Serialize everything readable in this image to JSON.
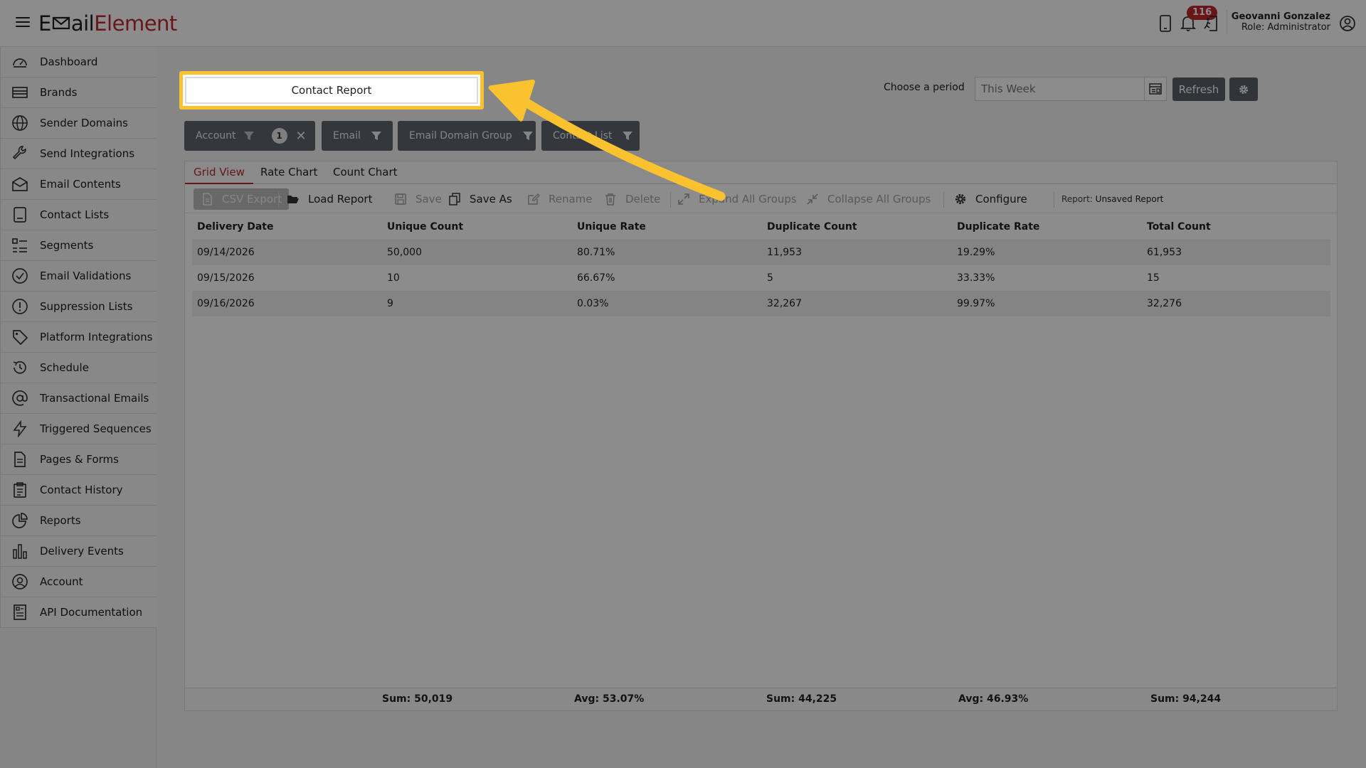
{
  "header": {
    "logo_part1": "E",
    "logo_part2": "ail",
    "logo_part3": "Element",
    "notification_count": "116",
    "user_name": "Geovanni Gonzalez",
    "user_role": "Role: Administrator"
  },
  "sidebar": {
    "items": [
      {
        "label": "Dashboard",
        "icon": "dashboard-icon"
      },
      {
        "label": "Brands",
        "icon": "brands-icon"
      },
      {
        "label": "Sender Domains",
        "icon": "globe-icon"
      },
      {
        "label": "Send Integrations",
        "icon": "wrench-icon"
      },
      {
        "label": "Email Contents",
        "icon": "envelope-icon"
      },
      {
        "label": "Contact Lists",
        "icon": "contacts-icon"
      },
      {
        "label": "Segments",
        "icon": "segments-icon"
      },
      {
        "label": "Email Validations",
        "icon": "check-circle-icon"
      },
      {
        "label": "Suppression Lists",
        "icon": "exclamation-circle-icon"
      },
      {
        "label": "Platform Integrations",
        "icon": "tag-icon"
      },
      {
        "label": "Schedule",
        "icon": "history-icon"
      },
      {
        "label": "Transactional Emails",
        "icon": "at-icon"
      },
      {
        "label": "Triggered Sequences",
        "icon": "bolt-icon"
      },
      {
        "label": "Pages & Forms",
        "icon": "document-icon"
      },
      {
        "label": "Contact History",
        "icon": "clipboard-icon"
      },
      {
        "label": "Reports",
        "icon": "pie-chart-icon"
      },
      {
        "label": "Delivery Events",
        "icon": "bar-chart-icon"
      },
      {
        "label": "Account",
        "icon": "user-circle-icon"
      },
      {
        "label": "API Documentation",
        "icon": "api-doc-icon"
      }
    ]
  },
  "main": {
    "report_title": "Contact Report",
    "period_label": "Choose a period",
    "period_value": "This Week",
    "refresh_label": "Refresh",
    "filters": [
      {
        "label": "Account",
        "count": "1"
      },
      {
        "label": "Email"
      },
      {
        "label": "Email Domain Group"
      },
      {
        "label": "Contact List"
      }
    ],
    "tabs": [
      "Grid View",
      "Rate Chart",
      "Count Chart"
    ],
    "toolbar": {
      "csv_export": "CSV Export",
      "load_report": "Load Report",
      "save": "Save",
      "save_as": "Save As",
      "rename": "Rename",
      "delete": "Delete",
      "expand_all": "Expand All Groups",
      "collapse_all": "Collapse All Groups",
      "configure": "Configure",
      "report_label": "Report:",
      "report_name": "Unsaved Report"
    },
    "table": {
      "columns": [
        "Delivery Date",
        "Unique Count",
        "Unique Rate",
        "Duplicate Count",
        "Duplicate Rate",
        "Total Count"
      ],
      "rows": [
        [
          "09/14/2026",
          "50,000",
          "80.71%",
          "11,953",
          "19.29%",
          "61,953"
        ],
        [
          "09/15/2026",
          "10",
          "66.67%",
          "5",
          "33.33%",
          "15"
        ],
        [
          "09/16/2026",
          "9",
          "0.03%",
          "32,267",
          "99.97%",
          "32,276"
        ]
      ],
      "footer": [
        "Sum: 50,019",
        "Avg: 53.07%",
        "Sum: 44,225",
        "Avg: 46.93%",
        "Sum: 94,244"
      ]
    }
  },
  "colors": {
    "brand_red": "#c0282f",
    "highlight_yellow": "#f9c22e",
    "filter_bg": "#5f676d"
  }
}
